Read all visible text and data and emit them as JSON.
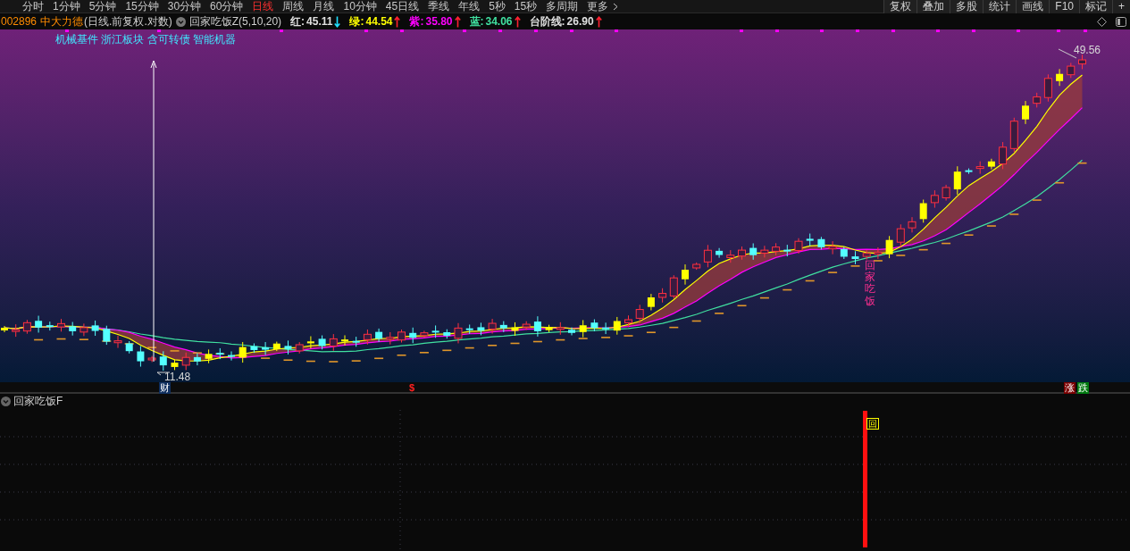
{
  "toolbar": {
    "periods": [
      {
        "label": "分时",
        "selected": false
      },
      {
        "label": "1分钟",
        "selected": false
      },
      {
        "label": "5分钟",
        "selected": false
      },
      {
        "label": "15分钟",
        "selected": false
      },
      {
        "label": "30分钟",
        "selected": false
      },
      {
        "label": "60分钟",
        "selected": false
      },
      {
        "label": "日线",
        "selected": true
      },
      {
        "label": "周线",
        "selected": false
      },
      {
        "label": "月线",
        "selected": false
      },
      {
        "label": "10分钟",
        "selected": false
      },
      {
        "label": "45日线",
        "selected": false
      },
      {
        "label": "季线",
        "selected": false
      },
      {
        "label": "年线",
        "selected": false
      },
      {
        "label": "5秒",
        "selected": false
      },
      {
        "label": "15秒",
        "selected": false
      },
      {
        "label": "多周期",
        "selected": false
      },
      {
        "label": "更多",
        "selected": false
      }
    ],
    "tools": [
      "复权",
      "叠加",
      "多股",
      "统计",
      "画线",
      "F10",
      "标记",
      "+"
    ]
  },
  "header": {
    "code": "002896",
    "name": "中大力德",
    "mode": "(日线.前复权.对数)",
    "indicator": "回家吃饭Z(5,10,20)",
    "readings": [
      {
        "label": "红:",
        "value": "45.11",
        "color": "#e0e0e0",
        "rising": false
      },
      {
        "label": "绿:",
        "value": "44.54",
        "color": "#ffff00",
        "rising": true
      },
      {
        "label": "紫:",
        "value": "35.80",
        "color": "#ff00ff",
        "rising": true
      },
      {
        "label": "蓝:",
        "value": "34.06",
        "color": "#40e0a0",
        "rising": true
      },
      {
        "label": "台阶线:",
        "value": "26.90",
        "color": "#e0e0e0",
        "rising": true
      }
    ]
  },
  "chart": {
    "concepts": "机械基件 浙江板块 含可转债 智能机器",
    "high_label": "49.56",
    "low_label": "11.48",
    "signal_text": "回家吃饭",
    "axis_marks": [
      {
        "text": "财",
        "kind": "news"
      },
      {
        "text": "$",
        "kind": "dividend"
      },
      {
        "text": "涨",
        "kind": "rise"
      },
      {
        "text": "跌",
        "kind": "fall"
      }
    ]
  },
  "lower_panel": {
    "title": "回家吃饭F",
    "marker": "回"
  }
}
